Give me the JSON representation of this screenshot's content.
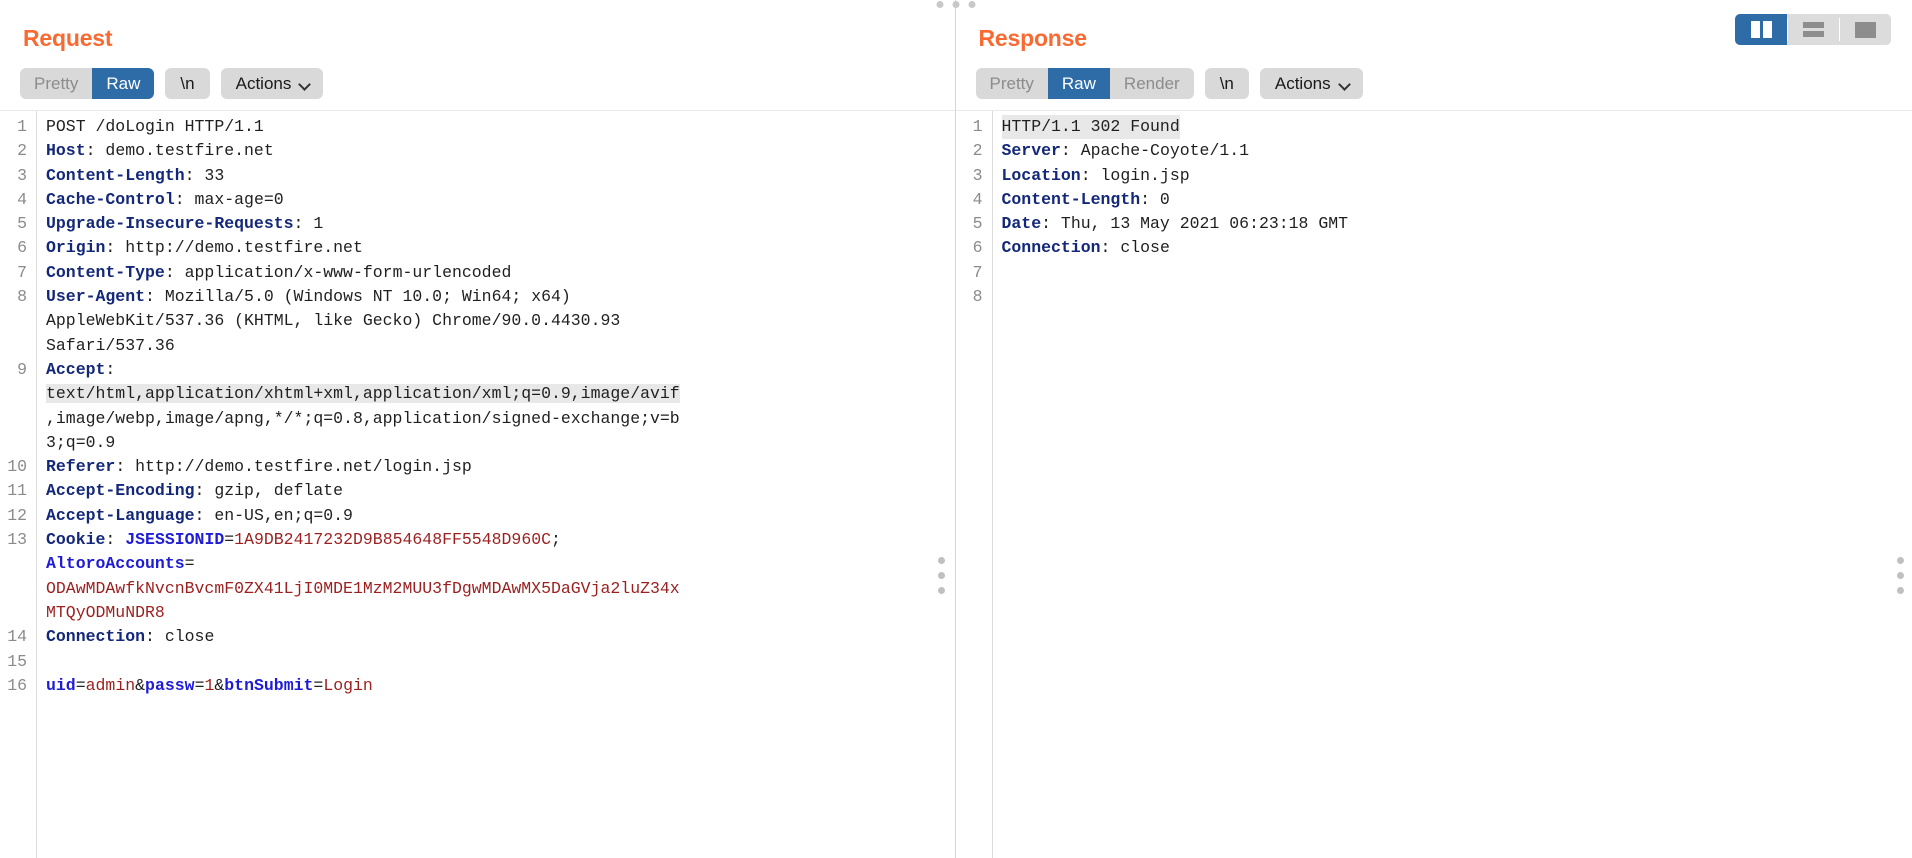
{
  "window": {
    "layout_toggle": {
      "options": [
        {
          "name": "split-view",
          "label": "",
          "selected": true
        },
        {
          "name": "stacked-view",
          "label": "",
          "selected": false
        },
        {
          "name": "single-view",
          "label": "",
          "selected": false
        }
      ]
    },
    "accent_color": "#f96a33",
    "selection_color": "#2d6ca6",
    "highlight_color": "#e8e8e8"
  },
  "request": {
    "title": "Request",
    "tabs": [
      {
        "label": "Pretty",
        "active": false
      },
      {
        "label": "Raw",
        "active": true
      }
    ],
    "newline_button": "\\n",
    "actions_button": "Actions",
    "lines": [
      {
        "num": "1",
        "segments": [
          {
            "t": "POST /doLogin HTTP/1.1",
            "c": "plain"
          }
        ]
      },
      {
        "num": "2",
        "segments": [
          {
            "t": "Host",
            "c": "name"
          },
          {
            "t": ": demo.testfire.net",
            "c": "plain"
          }
        ]
      },
      {
        "num": "3",
        "segments": [
          {
            "t": "Content-Length",
            "c": "name"
          },
          {
            "t": ": 33",
            "c": "plain"
          }
        ]
      },
      {
        "num": "4",
        "segments": [
          {
            "t": "Cache-Control",
            "c": "name"
          },
          {
            "t": ": max-age=0",
            "c": "plain"
          }
        ]
      },
      {
        "num": "5",
        "segments": [
          {
            "t": "Upgrade-Insecure-Requests",
            "c": "name"
          },
          {
            "t": ": 1",
            "c": "plain"
          }
        ]
      },
      {
        "num": "6",
        "segments": [
          {
            "t": "Origin",
            "c": "name"
          },
          {
            "t": ": http://demo.testfire.net",
            "c": "plain"
          }
        ]
      },
      {
        "num": "7",
        "segments": [
          {
            "t": "Content-Type",
            "c": "name"
          },
          {
            "t": ": application/x-www-form-urlencoded",
            "c": "plain"
          }
        ]
      },
      {
        "num": "8",
        "segments": [
          {
            "t": "User-Agent",
            "c": "name"
          },
          {
            "t": ": Mozilla/5.0 (Windows NT 10.0; Win64; x64)",
            "c": "plain"
          }
        ]
      },
      {
        "num": "",
        "segments": [
          {
            "t": "AppleWebKit/537.36 (KHTML, like Gecko) Chrome/90.0.4430.93",
            "c": "plain"
          }
        ]
      },
      {
        "num": "",
        "segments": [
          {
            "t": "Safari/537.36",
            "c": "plain"
          }
        ]
      },
      {
        "num": "9",
        "segments": [
          {
            "t": "Accept",
            "c": "name"
          },
          {
            "t": ":",
            "c": "plain"
          }
        ]
      },
      {
        "num": "",
        "highlight": true,
        "segments": [
          {
            "t": "text/html,application/xhtml+xml,application/xml;q=0.9,image/avif",
            "c": "plain"
          }
        ]
      },
      {
        "num": "",
        "segments": [
          {
            "t": ",image/webp,image/apng,*/*;q=0.8,application/signed-exchange;v=b",
            "c": "plain"
          }
        ]
      },
      {
        "num": "",
        "segments": [
          {
            "t": "3;q=0.9",
            "c": "plain"
          }
        ]
      },
      {
        "num": "10",
        "segments": [
          {
            "t": "Referer",
            "c": "name"
          },
          {
            "t": ": http://demo.testfire.net/login.jsp",
            "c": "plain"
          }
        ]
      },
      {
        "num": "11",
        "segments": [
          {
            "t": "Accept-Encoding",
            "c": "name"
          },
          {
            "t": ": gzip, deflate",
            "c": "plain"
          }
        ]
      },
      {
        "num": "12",
        "segments": [
          {
            "t": "Accept-Language",
            "c": "name"
          },
          {
            "t": ": en-US,en;q=0.9",
            "c": "plain"
          }
        ]
      },
      {
        "num": "13",
        "segments": [
          {
            "t": "Cookie",
            "c": "name"
          },
          {
            "t": ": ",
            "c": "plain"
          },
          {
            "t": "JSESSIONID",
            "c": "key"
          },
          {
            "t": "=",
            "c": "plain"
          },
          {
            "t": "1A9DB2417232D9B854648FF5548D960C",
            "c": "val"
          },
          {
            "t": ";",
            "c": "plain"
          }
        ]
      },
      {
        "num": "",
        "segments": [
          {
            "t": "AltoroAccounts",
            "c": "key"
          },
          {
            "t": "=",
            "c": "plain"
          }
        ]
      },
      {
        "num": "",
        "segments": [
          {
            "t": "ODAwMDAwfkNvcnBvcmF0ZX41LjI0MDE1MzM2MUU3fDgwMDAwMX5DaGVja2luZ34x",
            "c": "val"
          }
        ]
      },
      {
        "num": "",
        "segments": [
          {
            "t": "MTQyODMuNDR8",
            "c": "val"
          }
        ]
      },
      {
        "num": "14",
        "segments": [
          {
            "t": "Connection",
            "c": "name"
          },
          {
            "t": ": close",
            "c": "plain"
          }
        ]
      },
      {
        "num": "15",
        "segments": [
          {
            "t": "",
            "c": "plain"
          }
        ]
      },
      {
        "num": "16",
        "segments": [
          {
            "t": "uid",
            "c": "key"
          },
          {
            "t": "=",
            "c": "plain"
          },
          {
            "t": "admin",
            "c": "val"
          },
          {
            "t": "&",
            "c": "plain"
          },
          {
            "t": "passw",
            "c": "key"
          },
          {
            "t": "=",
            "c": "plain"
          },
          {
            "t": "1",
            "c": "val"
          },
          {
            "t": "&",
            "c": "plain"
          },
          {
            "t": "btnSubmit",
            "c": "key"
          },
          {
            "t": "=",
            "c": "plain"
          },
          {
            "t": "Login",
            "c": "val"
          }
        ]
      }
    ]
  },
  "response": {
    "title": "Response",
    "tabs": [
      {
        "label": "Pretty",
        "active": false
      },
      {
        "label": "Raw",
        "active": true
      },
      {
        "label": "Render",
        "active": false
      }
    ],
    "newline_button": "\\n",
    "actions_button": "Actions",
    "lines": [
      {
        "num": "1",
        "highlight": true,
        "full_width_highlight": true,
        "segments": [
          {
            "t": "HTTP/1.1 302 Found",
            "c": "plain"
          }
        ]
      },
      {
        "num": "2",
        "segments": [
          {
            "t": "Server",
            "c": "name"
          },
          {
            "t": ": Apache-Coyote/1.1",
            "c": "plain"
          }
        ]
      },
      {
        "num": "3",
        "segments": [
          {
            "t": "Location",
            "c": "name"
          },
          {
            "t": ": login.jsp",
            "c": "plain"
          }
        ]
      },
      {
        "num": "4",
        "segments": [
          {
            "t": "Content-Length",
            "c": "name"
          },
          {
            "t": ": 0",
            "c": "plain"
          }
        ]
      },
      {
        "num": "5",
        "segments": [
          {
            "t": "Date",
            "c": "name"
          },
          {
            "t": ": Thu, 13 May 2021 06:23:18 GMT",
            "c": "plain"
          }
        ]
      },
      {
        "num": "6",
        "segments": [
          {
            "t": "Connection",
            "c": "name"
          },
          {
            "t": ": close",
            "c": "plain"
          }
        ]
      },
      {
        "num": "7",
        "segments": [
          {
            "t": "",
            "c": "plain"
          }
        ]
      },
      {
        "num": "8",
        "segments": [
          {
            "t": "",
            "c": "plain"
          }
        ]
      }
    ]
  }
}
